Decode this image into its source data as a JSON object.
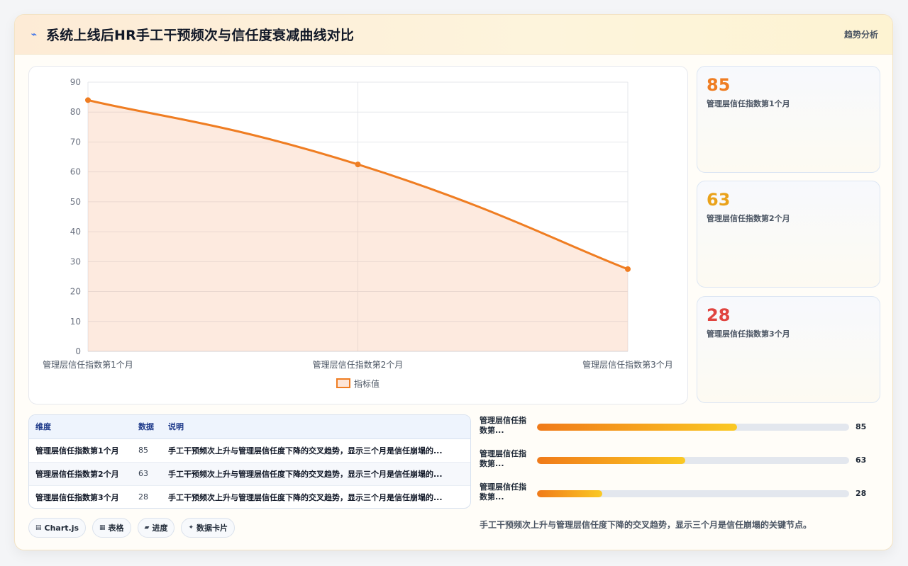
{
  "header": {
    "icon": "trend-icon",
    "title": "系统上线后HR手工干预频次与信任度衰减曲线对比",
    "tag": "趋势分析"
  },
  "chart_data": {
    "type": "area",
    "categories": [
      "管理层信任指数第1个月",
      "管理层信任指数第2个月",
      "管理层信任指数第3个月"
    ],
    "series": [
      {
        "name": "指标值",
        "values": [
          84,
          62.5,
          27.5
        ],
        "color": "#ef7d22"
      }
    ],
    "yticks": [
      "0",
      "10",
      "20",
      "30",
      "40",
      "50",
      "60",
      "70",
      "80",
      "90"
    ],
    "ylim": [
      0,
      90
    ],
    "grid": true,
    "legend": "bottom"
  },
  "stats": [
    {
      "value": "85",
      "label": "管理层信任指数第1个月",
      "color": "#ef7d22"
    },
    {
      "value": "63",
      "label": "管理层信任指数第2个月",
      "color": "#eaa21a"
    },
    {
      "value": "28",
      "label": "管理层信任指数第3个月",
      "color": "#e0443f"
    }
  ],
  "table": {
    "headers": [
      "维度",
      "数据",
      "说明"
    ],
    "rows": [
      [
        "管理层信任指数第1个月",
        "85",
        "手工干预频次上升与管理层信任度下降的交叉趋势，显示三个月是信任崩塌的..."
      ],
      [
        "管理层信任指数第2个月",
        "63",
        "手工干预频次上升与管理层信任度下降的交叉趋势，显示三个月是信任崩塌的..."
      ],
      [
        "管理层信任指数第3个月",
        "28",
        "手工干预频次上升与管理层信任度下降的交叉趋势，显示三个月是信任崩塌的..."
      ]
    ]
  },
  "chips": [
    {
      "icon": "chart-icon",
      "glyph": "▤",
      "label": "Chart.js"
    },
    {
      "icon": "table-icon",
      "glyph": "▦",
      "label": "表格"
    },
    {
      "icon": "progress-icon",
      "glyph": "▰",
      "label": "进度"
    },
    {
      "icon": "card-icon",
      "glyph": "✦",
      "label": "数据卡片"
    }
  ],
  "bars": [
    {
      "label": "管理层信任指数第...",
      "label_line1": "管理层信任指",
      "label_line2": "数第...",
      "value": "85",
      "fraction": 0.64
    },
    {
      "label": "管理层信任指数第...",
      "label_line1": "管理层信任指",
      "label_line2": "数第...",
      "value": "63",
      "fraction": 0.475
    },
    {
      "label": "管理层信任指数第...",
      "label_line1": "管理层信任指",
      "label_line2": "数第...",
      "value": "28",
      "fraction": 0.21
    }
  ],
  "summary": "手工干预频次上升与管理层信任度下降的交叉趋势，显示三个月是信任崩塌的关键节点。"
}
